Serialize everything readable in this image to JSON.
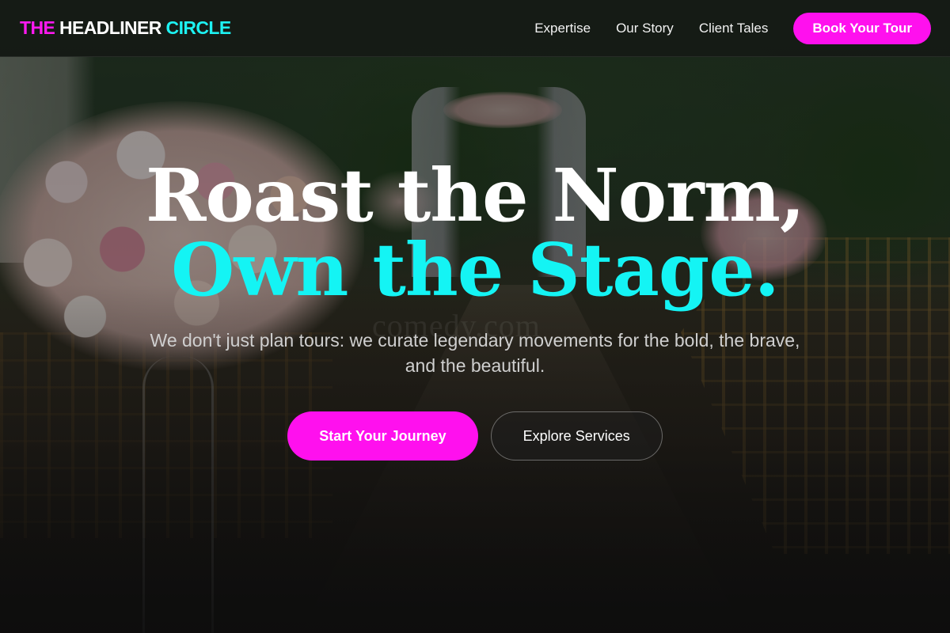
{
  "brand": {
    "part1": "THE",
    "part2": " HEADLINER",
    "part3": " CIRCLE",
    "colors": {
      "magenta": "#ff10ee",
      "cyan": "#14f4f4"
    }
  },
  "nav": {
    "links": [
      "Expertise",
      "Our Story",
      "Client Tales"
    ],
    "cta_label": "Book Your Tour"
  },
  "hero": {
    "headline_line1": "Roast the Norm,",
    "headline_line2": "Own the Stage.",
    "subtext": "We don't just plan tours: we curate legendary movements for the bold, the brave, and the beautiful.",
    "primary_cta": "Start Your Journey",
    "secondary_cta": "Explore Services",
    "background_watermark": "comedy.com"
  }
}
